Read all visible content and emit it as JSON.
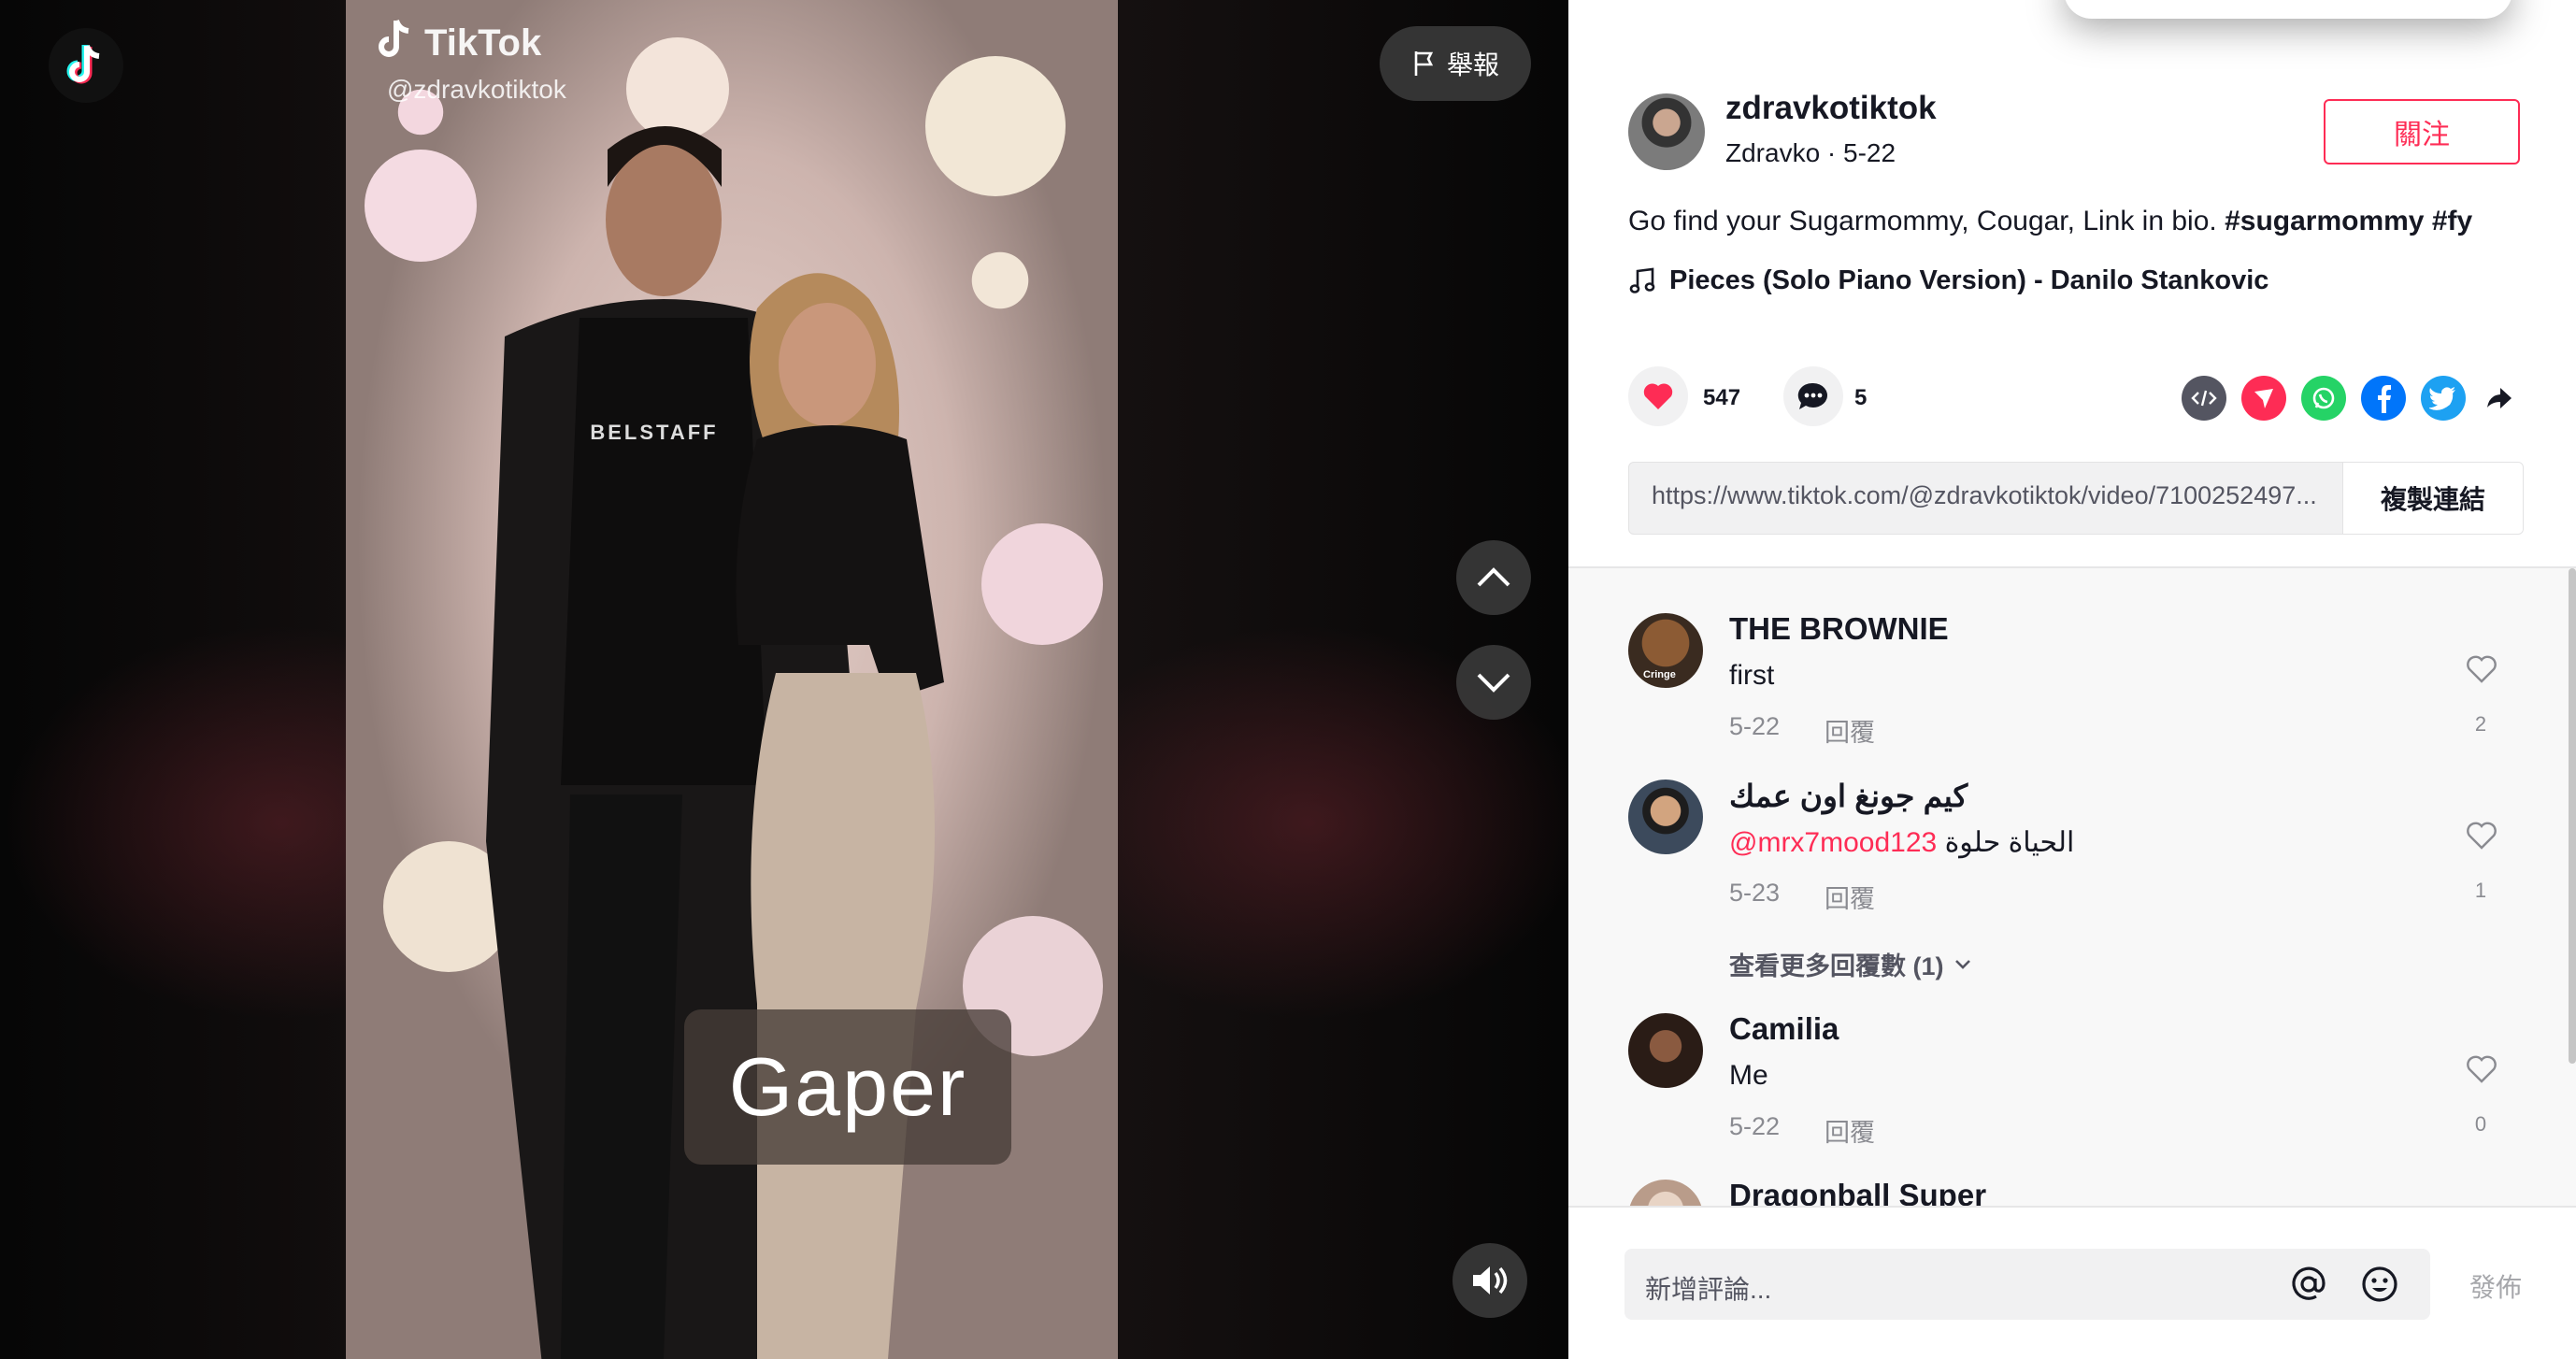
{
  "video": {
    "watermark_brand": "TikTok",
    "watermark_user": "@zdravkotiktok",
    "caption_overlay": "Gaper",
    "shirt_text": "BELSTAFF",
    "report_label": "舉報"
  },
  "author": {
    "handle": "zdravkotiktok",
    "meta": "Zdravko · 5-22",
    "follow_label": "關注"
  },
  "post": {
    "description": "Go find your Sugarmommy, Cougar, Link in bio. ",
    "hashtag1": "#sugarmommy",
    "hashtag2": "#fy",
    "music": "Pieces (Solo Piano Version) - Danilo Stankovic"
  },
  "stats": {
    "likes": "547",
    "comments": "5"
  },
  "share": {
    "icons": [
      "embed-icon",
      "send-icon",
      "whatsapp-icon",
      "facebook-icon",
      "twitter-icon",
      "share-arrow-icon"
    ],
    "colors": {
      "embed": "#545561",
      "send": "#fe2c55",
      "whatsapp": "#25d366",
      "facebook": "#0075fa",
      "twitter": "#1da1f2"
    }
  },
  "link": {
    "url": "https://www.tiktok.com/@zdravkotiktok/video/7100252497...",
    "copy_label": "複製連結"
  },
  "comments": [
    {
      "user": "THE BROWNIE",
      "text": "first",
      "date": "5-22",
      "reply": "回覆",
      "likes": "2",
      "avatar_label": "Cringe"
    },
    {
      "user": "كيم جونغ اون عمك",
      "mention": "@mrx7mood123",
      "text": " الحياة حلوة",
      "date": "5-23",
      "reply": "回覆",
      "likes": "1"
    },
    {
      "user": "Camilia",
      "text": "Me",
      "date": "5-22",
      "reply": "回覆",
      "likes": "0"
    },
    {
      "user": "Dragonball Super"
    }
  ],
  "more_replies": "查看更多回覆數 (1)",
  "composer": {
    "placeholder": "新增評論...",
    "post_label": "發佈"
  },
  "theme": {
    "accent": "#fe2c55",
    "text": "#161823",
    "muted": "#8a8b91"
  }
}
